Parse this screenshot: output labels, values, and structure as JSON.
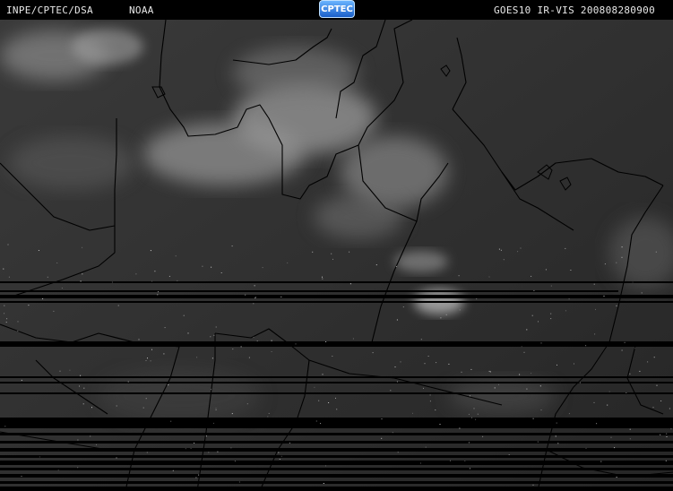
{
  "header": {
    "org": "INPE/CPTEC/DSA",
    "agency": "NOAA",
    "logo_text": "CPTEC",
    "sat_info": "GOES10  IR-VIS 200808280900"
  },
  "colors": {
    "background": "#2b2b2b",
    "clouds": "#8a8a8a",
    "borders": "#000000",
    "scanline_gaps": "#000000"
  }
}
